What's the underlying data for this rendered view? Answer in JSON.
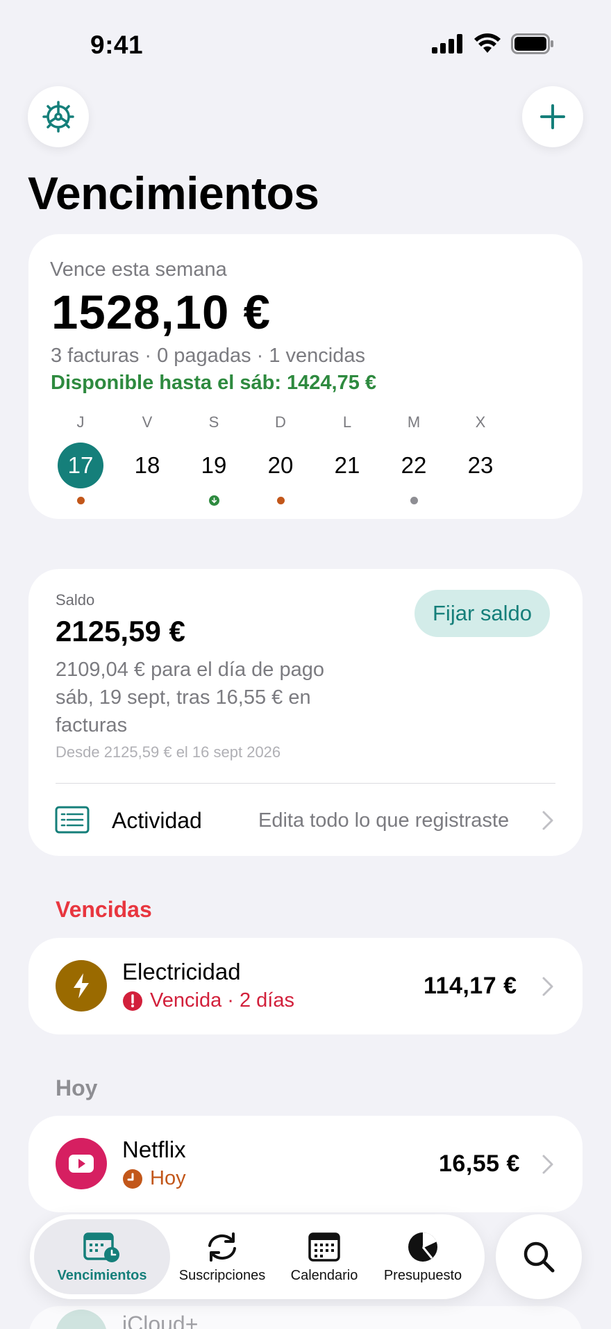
{
  "status_bar": {
    "time": "9:41"
  },
  "page": {
    "title": "Vencimientos"
  },
  "week": {
    "label": "Vence esta semana",
    "total": "1528,10 €",
    "summary": "3 facturas · 0 pagadas · 1 vencidas",
    "available": "Disponible hasta el sáb: 1424,75 €",
    "days": [
      {
        "letter": "J",
        "number": "17",
        "selected": true,
        "marker": "orange-dot"
      },
      {
        "letter": "V",
        "number": "18",
        "selected": false,
        "marker": "none"
      },
      {
        "letter": "S",
        "number": "19",
        "selected": false,
        "marker": "green-down-arrow"
      },
      {
        "letter": "D",
        "number": "20",
        "selected": false,
        "marker": "orange-dot"
      },
      {
        "letter": "L",
        "number": "21",
        "selected": false,
        "marker": "none"
      },
      {
        "letter": "M",
        "number": "22",
        "selected": false,
        "marker": "gray-dot"
      },
      {
        "letter": "X",
        "number": "23",
        "selected": false,
        "marker": "none"
      }
    ]
  },
  "balance": {
    "label": "Saldo",
    "value": "2125,59 €",
    "description": "2109,04 € para el día de pago sáb, 19 sept, tras 16,55 € en facturas",
    "since": "Desde 2125,59 € el 16 sept 2026",
    "set_button": "Fijar saldo",
    "activity_label": "Actividad",
    "activity_hint": "Edita todo lo que registraste"
  },
  "overdue": {
    "section_title": "Vencidas",
    "items": [
      {
        "name": "Electricidad",
        "status": "Vencida · 2 días",
        "amount": "114,17 €",
        "icon": "bolt-icon"
      }
    ]
  },
  "today": {
    "section_title": "Hoy",
    "items": [
      {
        "name": "Netflix",
        "status": "Hoy",
        "amount": "16,55 €",
        "icon": "play-icon"
      }
    ]
  },
  "peek_item": {
    "name": "iCloud+"
  },
  "tabbar": {
    "tabs": [
      {
        "label": "Vencimientos",
        "icon": "calendar-clock-icon",
        "active": true
      },
      {
        "label": "Suscripciones",
        "icon": "repeat-icon",
        "active": false
      },
      {
        "label": "Calendario",
        "icon": "calendar-icon",
        "active": false
      },
      {
        "label": "Presupuesto",
        "icon": "pie-chart-icon",
        "active": false
      }
    ],
    "search_icon": "search-icon"
  },
  "colors": {
    "accent": "#157f7a",
    "overdue": "#d2203b",
    "today": "#c2571a",
    "available": "#2e8a3f",
    "electricity": "#9a6a00",
    "netflix": "#d61f61"
  }
}
